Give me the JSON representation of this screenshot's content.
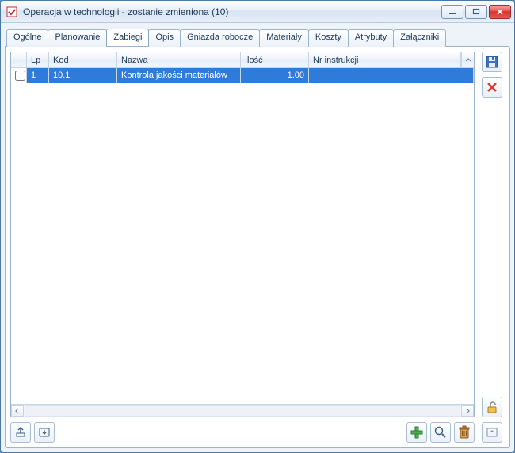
{
  "window": {
    "title": "Operacja w technologii - zostanie zmieniona  (10)"
  },
  "tabs": [
    {
      "label": "Ogólne"
    },
    {
      "label": "Planowanie"
    },
    {
      "label": "Zabiegi",
      "active": true
    },
    {
      "label": "Opis"
    },
    {
      "label": "Gniazda robocze"
    },
    {
      "label": "Materiały"
    },
    {
      "label": "Koszty"
    },
    {
      "label": "Atrybuty"
    },
    {
      "label": "Załączniki"
    }
  ],
  "grid": {
    "columns": {
      "lp": "Lp",
      "kod": "Kod",
      "nazwa": "Nazwa",
      "ilosc": "Ilość",
      "instr": "Nr instrukcji"
    },
    "rows": [
      {
        "lp": "1",
        "kod": "10.1",
        "nazwa": "Kontrola jakości materiałów",
        "ilosc": "1.00",
        "instr": ""
      }
    ]
  }
}
